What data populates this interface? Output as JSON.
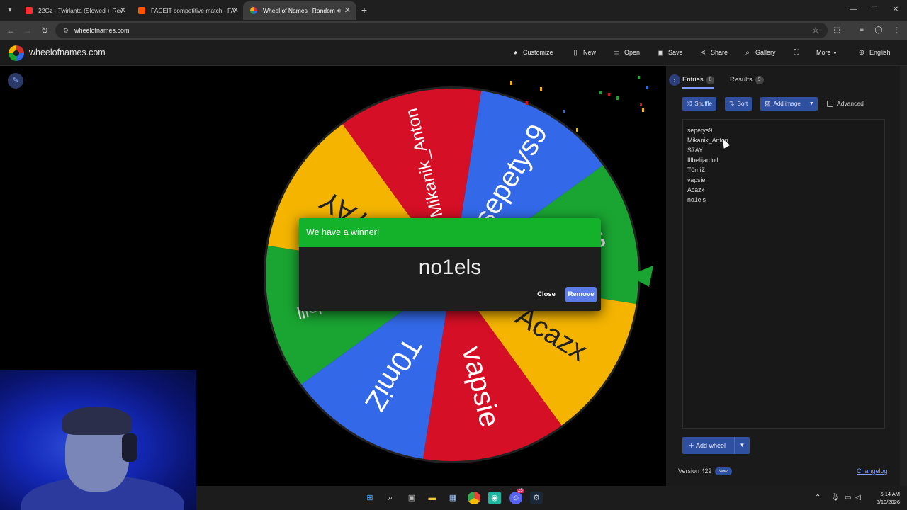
{
  "browser": {
    "tabs": [
      {
        "title": "22Gz - Twirlanta (Slowed + Rev",
        "color": "#ff2d2d"
      },
      {
        "title": "FACEIT competitive match - FA",
        "color": "#ff5500"
      },
      {
        "title": "Wheel of Names | Random",
        "color": "#6a8cff"
      }
    ],
    "url": "wheelofnames.com"
  },
  "header": {
    "site_title": "wheelofnames.com",
    "buttons": {
      "customize": "Customize",
      "new": "New",
      "open": "Open",
      "save": "Save",
      "share": "Share",
      "gallery": "Gallery",
      "more": "More",
      "language": "English"
    }
  },
  "wheel": {
    "segments": [
      {
        "label": "sepetys9",
        "color": "#3369e8"
      },
      {
        "label": "no1els",
        "color": "#1aa532"
      },
      {
        "label": "Acazx",
        "color": "#f4b400"
      },
      {
        "label": "vapsie",
        "color": "#d50f25"
      },
      {
        "label": "T0miZ",
        "color": "#3369e8"
      },
      {
        "label": "Illbelijardolll",
        "color": "#1aa532"
      },
      {
        "label": "S7AY",
        "color": "#f4b400"
      },
      {
        "label": "Mikanik_Anton",
        "color": "#d50f25"
      }
    ],
    "pointer_color": "#1aa532"
  },
  "dialog": {
    "title": "We have a winner!",
    "winner": "no1els",
    "close_label": "Close",
    "remove_label": "Remove"
  },
  "panel": {
    "tabs": [
      {
        "label": "Entries",
        "count": "8"
      },
      {
        "label": "Results",
        "count": "9"
      }
    ],
    "buttons": {
      "shuffle": "Shuffle",
      "sort": "Sort",
      "add_image": "Add image",
      "advanced": "Advanced"
    },
    "entries": [
      "sepetys9",
      "Mikanik_Anton",
      "S7AY",
      "Illbelijardolll",
      "T0miZ",
      "vapsie",
      "Acazx",
      "no1els"
    ],
    "add_wheel": "Add wheel",
    "version": "Version 422",
    "new_badge": "New!",
    "changelog": "Changelog"
  },
  "taskbar": {
    "time": "5:14 AM",
    "date": "8/10/2026",
    "discord_badge": "25"
  }
}
